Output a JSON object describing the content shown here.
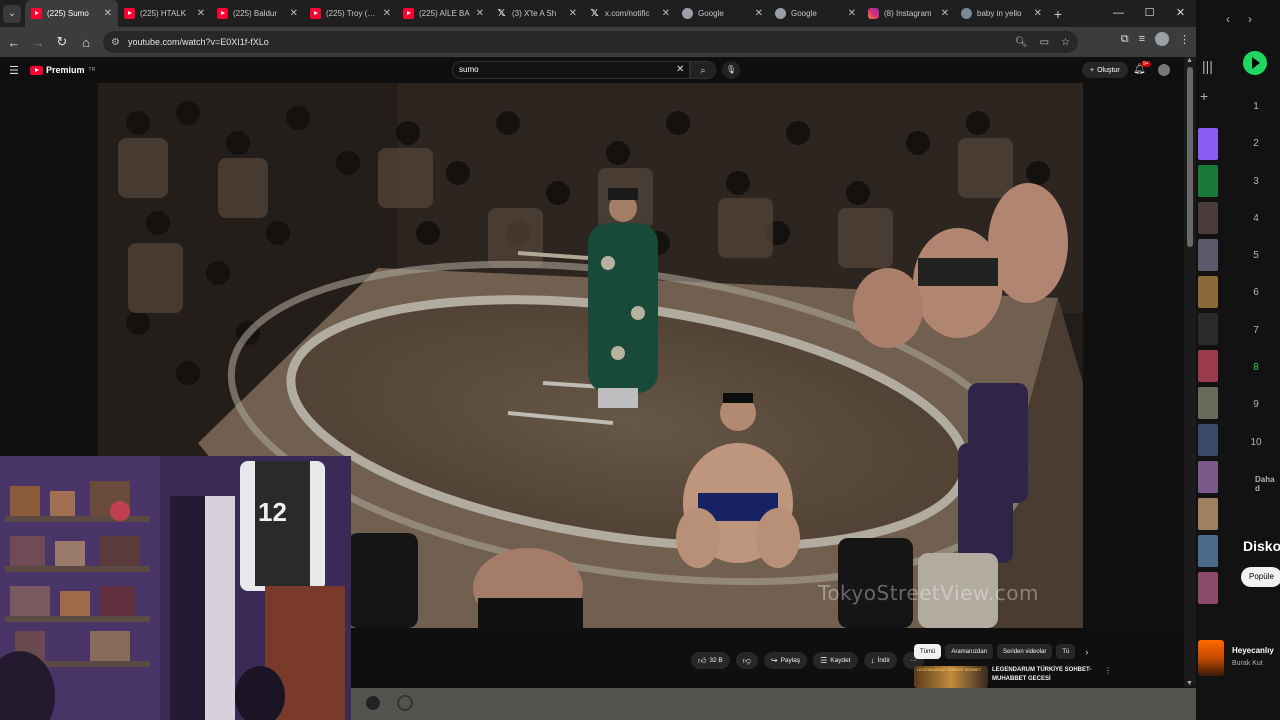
{
  "browser": {
    "tabs": [
      {
        "label": "(225) Sumo",
        "favicon": "youtube-icon",
        "active": true
      },
      {
        "label": "(225) HTALK",
        "favicon": "youtube-icon"
      },
      {
        "label": "(225) Baldur",
        "favicon": "youtube-icon"
      },
      {
        "label": "(225) Troy (2...",
        "favicon": "youtube-icon"
      },
      {
        "label": "(225) AİLE BA",
        "favicon": "youtube-icon"
      },
      {
        "label": "(3) X'te A Sh",
        "favicon": "x-icon"
      },
      {
        "label": "x.com/notific",
        "favicon": "x-icon"
      },
      {
        "label": "Google",
        "favicon": "google-icon"
      },
      {
        "label": "Google",
        "favicon": "google-icon"
      },
      {
        "label": "(8) Instagram",
        "favicon": "instagram-icon"
      },
      {
        "label": "baby in yello",
        "favicon": "web-icon"
      }
    ],
    "url": "youtube.com/watch?v=E0XI1f-fXLo"
  },
  "youtube": {
    "logo_text": "Premium",
    "logo_sup": "TR",
    "search_query": "sumo",
    "create_label": "Oluştur",
    "bell_badge": "9+",
    "watermark": "TokyoStreetView.com",
    "actions": [
      {
        "label": "32 B",
        "icon": "like-icon"
      },
      {
        "label": "",
        "icon": "dislike-icon"
      },
      {
        "label": "Paylaş",
        "icon": "share-icon"
      },
      {
        "label": "Kaydet",
        "icon": "save-icon"
      },
      {
        "label": "İndir",
        "icon": "download-icon"
      },
      {
        "label": "···",
        "icon": "more-icon"
      }
    ],
    "chips": [
      "Tümü",
      "Aramanızdan",
      "Seriden videolar",
      "Tü"
    ],
    "recommendation": {
      "thumb_text": "LEGENDARUM TÜRKİYE SOHBET",
      "title": "LEGENDARUM TÜRKİYE SOHBET-MUHABBET GECESİ"
    }
  },
  "spotify": {
    "numbers": [
      "1",
      "2",
      "3",
      "4",
      "5",
      "6",
      "7",
      "8",
      "9",
      "10"
    ],
    "active_number": "8",
    "more_label": "Daha d",
    "discover_label": "Disko",
    "popular_chip": "Popüle",
    "now_playing": {
      "title": "Heyecanlıy",
      "artist": "Burak Kut"
    },
    "accent": "#1ed760"
  }
}
